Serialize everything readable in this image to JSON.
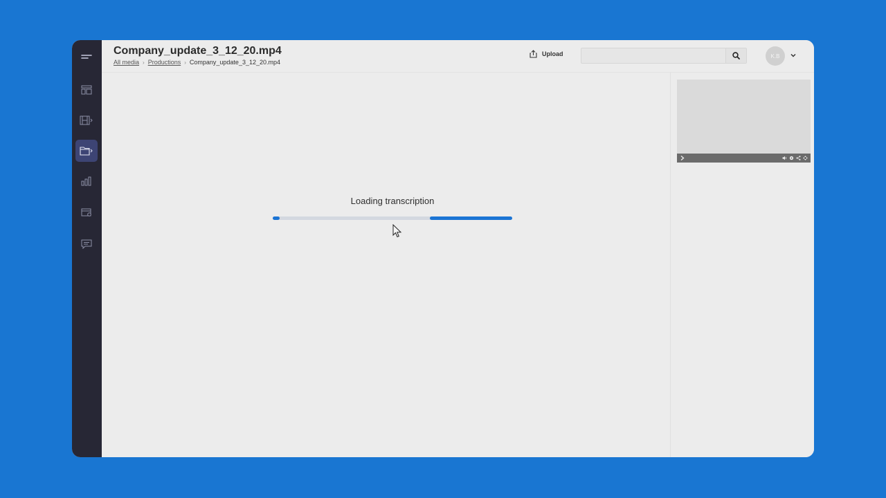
{
  "header": {
    "title": "Company_update_3_12_20.mp4",
    "breadcrumb": [
      "All media",
      "Productions",
      "Company_update_3_12_20.mp4"
    ],
    "upload_label": "Upload",
    "search_value": "",
    "avatar_initials": "K.B"
  },
  "sidebar": {
    "items": [
      {
        "icon": "menu-icon"
      },
      {
        "icon": "layout-icon"
      },
      {
        "icon": "film-icon"
      },
      {
        "icon": "folder-icon",
        "active": true
      },
      {
        "icon": "bar-chart-icon"
      },
      {
        "icon": "card-settings-icon"
      },
      {
        "icon": "comment-icon"
      }
    ]
  },
  "main": {
    "loading_text": "Loading transcription",
    "progress": {
      "segments": [
        [
          0.0,
          0.03
        ],
        [
          0.655,
          1.0
        ]
      ]
    }
  },
  "player": {
    "controls": [
      "play-icon",
      "volume-icon",
      "settings-icon",
      "share-icon",
      "fullscreen-icon"
    ]
  },
  "colors": {
    "background": "#1976d2",
    "sidebar": "#272735",
    "sidebar_active": "#3d4474",
    "accent": "#1b74d4"
  }
}
